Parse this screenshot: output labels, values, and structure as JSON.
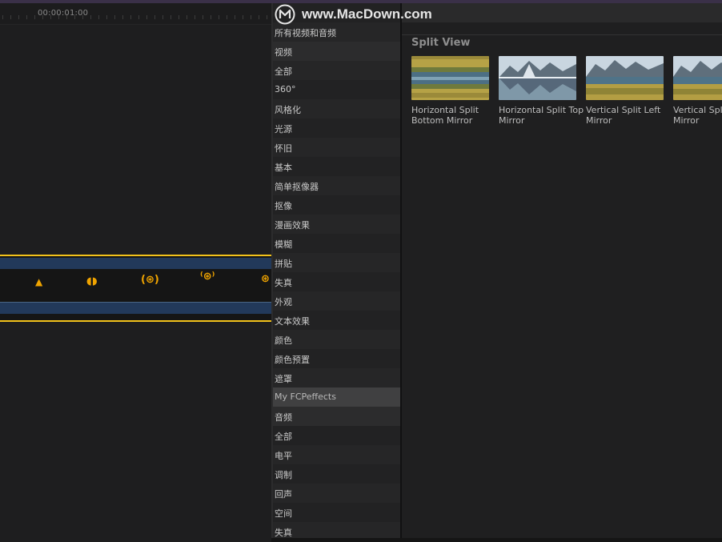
{
  "watermark": {
    "text": "www.MacDown.com",
    "icon": "macdown-logo-icon"
  },
  "timeline": {
    "timecode": "00:00:01:00"
  },
  "sidebar": {
    "items": [
      {
        "label": "所有视频和音频",
        "kind": "header"
      },
      {
        "label": "视频",
        "kind": "category"
      },
      {
        "label": "全部"
      },
      {
        "label": "360°"
      },
      {
        "label": "风格化"
      },
      {
        "label": "光源"
      },
      {
        "label": "怀旧"
      },
      {
        "label": "基本"
      },
      {
        "label": "简单抠像器"
      },
      {
        "label": "抠像"
      },
      {
        "label": "漫画效果"
      },
      {
        "label": "模糊"
      },
      {
        "label": "拼贴"
      },
      {
        "label": "失真"
      },
      {
        "label": "外观"
      },
      {
        "label": "文本效果"
      },
      {
        "label": "颜色"
      },
      {
        "label": "颜色预置"
      },
      {
        "label": "遮罩"
      },
      {
        "label": "My FCPeffects",
        "kind": "selected"
      },
      {
        "label": "音频",
        "kind": "category"
      },
      {
        "label": "全部"
      },
      {
        "label": "电平"
      },
      {
        "label": "调制"
      },
      {
        "label": "回声"
      },
      {
        "label": "空间"
      },
      {
        "label": "失真"
      }
    ]
  },
  "content": {
    "section_title": "Split View",
    "effects": [
      {
        "name": "Horizontal Split Bottom Mirror",
        "thumb": "grass-bottom-mirror"
      },
      {
        "name": "Horizontal Split Top Mirror",
        "thumb": "mountain-lake"
      },
      {
        "name": "Vertical Split Left Mirror",
        "thumb": "mountain-grass"
      },
      {
        "name": "Vertical Split Right Mirror",
        "thumb": "mountain-grass-right"
      }
    ]
  },
  "colors": {
    "clip_border": "#f2c21b",
    "clip_band": "#22395a",
    "selected_row": "#404041"
  }
}
